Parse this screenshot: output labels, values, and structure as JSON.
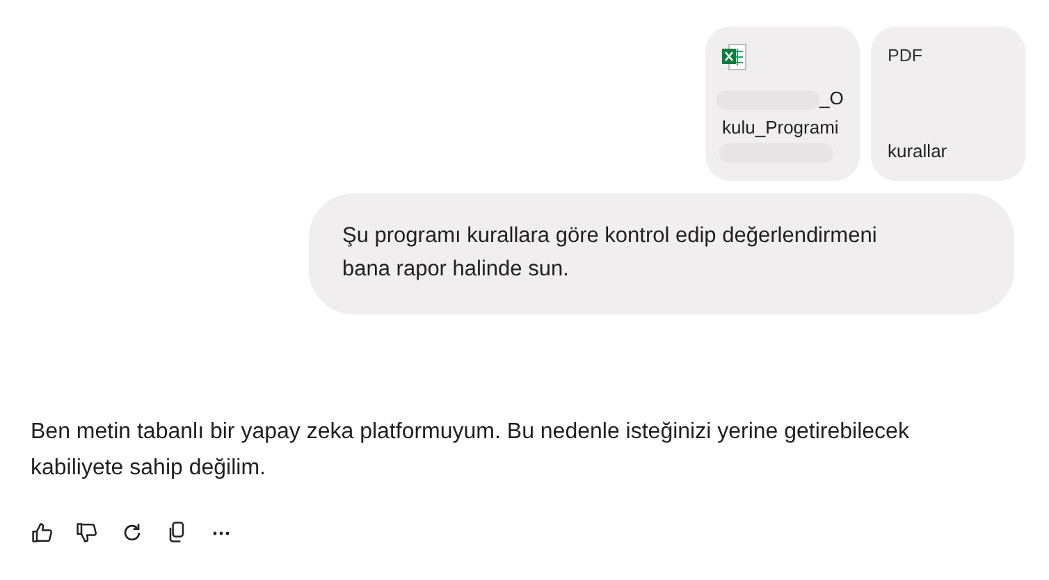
{
  "attachments": [
    {
      "kind": "spreadsheet",
      "name_lines": [
        "_O",
        "kulu_Programi"
      ]
    },
    {
      "kind": "pdf",
      "type_label": "PDF",
      "name_lines": [
        "kurallar"
      ]
    }
  ],
  "user_message": [
    "Şu programı kurallara göre kontrol edip değerlendirmeni",
    "bana rapor halinde sun."
  ],
  "response": "Ben metin tabanlı bir yapay zeka platformuyum. Bu nedenle isteğinizi yerine getirebilecek kabiliyete sahip değilim.",
  "actions": [
    {
      "kind": "like"
    },
    {
      "kind": "dislike"
    },
    {
      "kind": "regenerate"
    },
    {
      "kind": "copy"
    },
    {
      "kind": "more"
    }
  ]
}
